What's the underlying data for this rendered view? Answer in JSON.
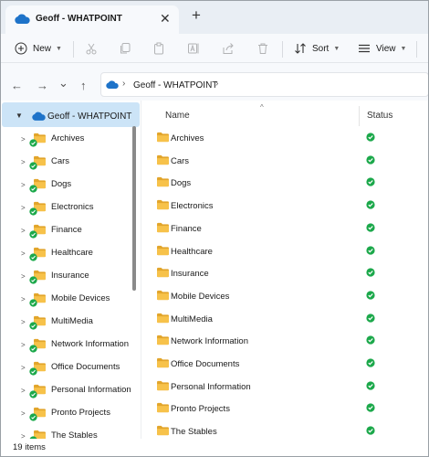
{
  "window": {
    "tab_title": "Geoff - WHATPOINT",
    "close_glyph": "✕",
    "new_tab_glyph": "+"
  },
  "toolbar": {
    "new_label": "New",
    "sort_label": "Sort",
    "view_label": "View",
    "icons": [
      "plus-icon",
      "cut-icon",
      "copy-icon",
      "paste-icon",
      "rename-icon",
      "share-icon",
      "delete-icon",
      "sort-icon",
      "view-icon"
    ]
  },
  "nav_buttons": {
    "back": "←",
    "forward": "→",
    "recent": "⌄",
    "up": "↑"
  },
  "address": {
    "sep": "›",
    "location": "Geoff - WHATPOINT"
  },
  "sidebar": {
    "root_label": "Geoff - WHATPOINT",
    "items": [
      "Archives",
      "Cars",
      "Dogs",
      "Electronics",
      "Finance",
      "Healthcare",
      "Insurance",
      "Mobile Devices",
      "MultiMedia",
      "Network Information",
      "Office Documents",
      "Personal Information",
      "Pronto Projects",
      "The Stables"
    ]
  },
  "list": {
    "columns": {
      "name": "Name",
      "status": "Status"
    },
    "rows": [
      {
        "name": "Archives",
        "status": "synced"
      },
      {
        "name": "Cars",
        "status": "synced"
      },
      {
        "name": "Dogs",
        "status": "synced"
      },
      {
        "name": "Electronics",
        "status": "synced"
      },
      {
        "name": "Finance",
        "status": "synced"
      },
      {
        "name": "Healthcare",
        "status": "synced"
      },
      {
        "name": "Insurance",
        "status": "synced"
      },
      {
        "name": "Mobile Devices",
        "status": "synced"
      },
      {
        "name": "MultiMedia",
        "status": "synced"
      },
      {
        "name": "Network Information",
        "status": "synced"
      },
      {
        "name": "Office Documents",
        "status": "synced"
      },
      {
        "name": "Personal Information",
        "status": "synced"
      },
      {
        "name": "Pronto Projects",
        "status": "synced"
      },
      {
        "name": "The Stables",
        "status": "synced"
      }
    ]
  },
  "statusbar": {
    "count": "19 items"
  },
  "colors": {
    "folder": "#f7c24a",
    "folder_dark": "#e2a52b",
    "synced": "#1ba84a",
    "cloud": "#1e73c9",
    "selected": "#cce4f7"
  }
}
